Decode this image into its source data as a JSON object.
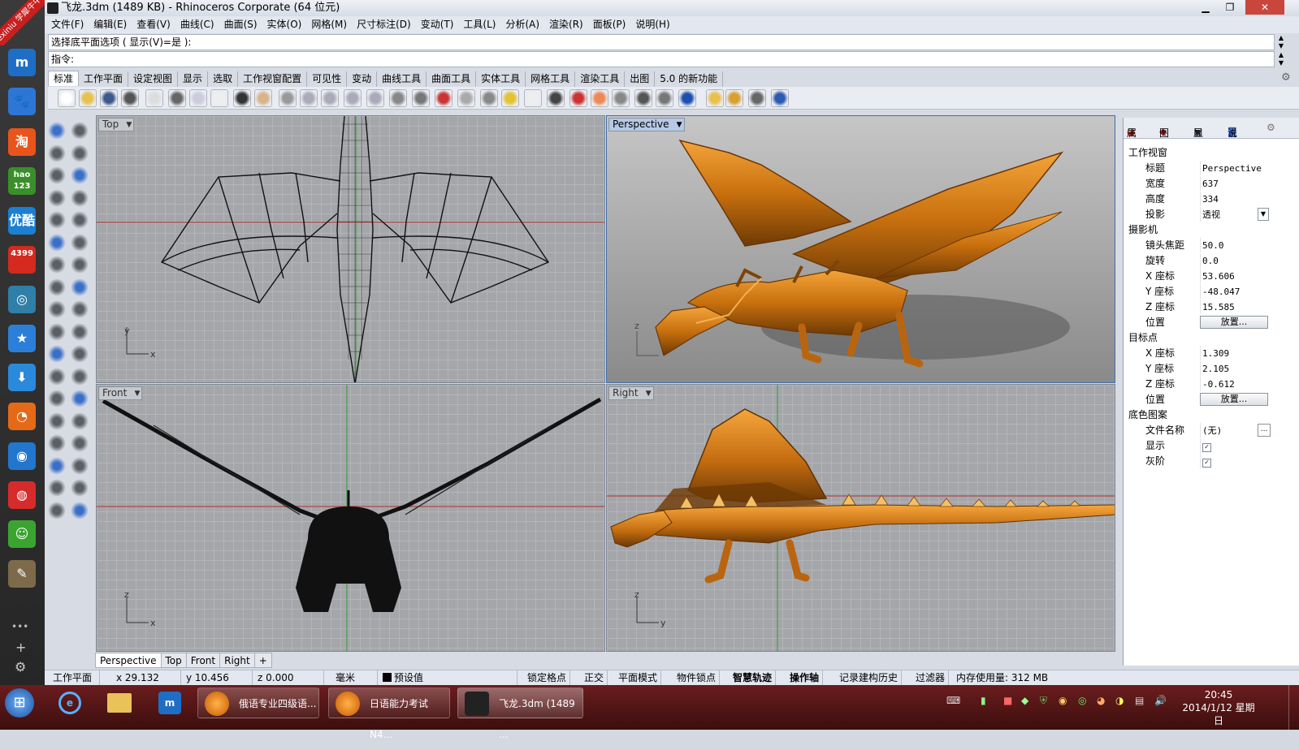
{
  "window": {
    "title": "飞龙.3dm (1489 KB) - Rhinoceros Corporate (64 位元)",
    "minimize": "▁",
    "restore": "❐",
    "close": "✕"
  },
  "dock_badge": {
    "line1": "xuexiniu",
    "line2": "学犀牛中文网"
  },
  "dock_items": [
    {
      "name": "maxthon-icon",
      "text": "m",
      "color": "#1f6ec6"
    },
    {
      "name": "baidu-icon",
      "text": "🐾",
      "color": "#2d76d6"
    },
    {
      "name": "taobao-icon",
      "text": "淘",
      "color": "#e8541c"
    },
    {
      "name": "hao123-icon",
      "text": "hao\n123",
      "color": "#3a8f2a"
    },
    {
      "name": "youku-icon",
      "text": "优酷",
      "color": "#1b7fd4"
    },
    {
      "name": "4399-icon",
      "text": "4399",
      "color": "#d42a1f"
    },
    {
      "name": "spiral-icon",
      "text": "◎",
      "color": "#2f7fa8"
    },
    {
      "name": "favorite-star-icon",
      "text": "★",
      "color": "#2c7fd8"
    },
    {
      "name": "download-icon",
      "text": "⬇",
      "color": "#2b89db"
    },
    {
      "name": "rss-icon",
      "text": "◔",
      "color": "#e46a18"
    },
    {
      "name": "game-controller-icon",
      "text": "◉",
      "color": "#2277cc"
    },
    {
      "name": "weibo-icon",
      "text": "◍",
      "color": "#d62b2b"
    },
    {
      "name": "smile-icon",
      "text": "☺",
      "color": "#3ba431"
    },
    {
      "name": "notepad-icon",
      "text": "✎",
      "color": "#7c6a4a"
    }
  ],
  "dock_more": "•••",
  "dock_add": "+",
  "dock_gear": "⚙",
  "menu": [
    "文件(F)",
    "编辑(E)",
    "查看(V)",
    "曲线(C)",
    "曲面(S)",
    "实体(O)",
    "网格(M)",
    "尺寸标注(D)",
    "变动(T)",
    "工具(L)",
    "分析(A)",
    "渲染(R)",
    "面板(P)",
    "说明(H)"
  ],
  "command_history": "选择底平面选项 ( 显示(V)=是 ):",
  "command_prompt": "指令:",
  "toolbar_tabs": [
    "标准",
    "工作平面",
    "设定视图",
    "显示",
    "选取",
    "工作视窗配置",
    "可见性",
    "变动",
    "曲线工具",
    "曲面工具",
    "实体工具",
    "网格工具",
    "渲染工具",
    "出图",
    "5.0 的新功能"
  ],
  "viewports": {
    "top": {
      "label": "Top"
    },
    "perspective": {
      "label": "Perspective"
    },
    "front": {
      "label": "Front"
    },
    "right": {
      "label": "Right"
    }
  },
  "axis_labels": {
    "x": "x",
    "y": "y",
    "z": "z"
  },
  "bottom_tabs": [
    "Perspective",
    "Top",
    "Front",
    "Right",
    "+"
  ],
  "status": {
    "cplane": "工作平面",
    "x": "x 29.132",
    "y": "y 10.456",
    "z": "z 0.000",
    "unit": "毫米",
    "layer": "预设值",
    "snap": "锁定格点",
    "ortho": "正交",
    "planar": "平面模式",
    "osnap": "物件锁点",
    "smarttrack": "智慧轨迹",
    "gumball": "操作轴",
    "history": "记录建构历史",
    "filter": "过滤器",
    "memory": "内存使用量: 312 MB"
  },
  "properties": {
    "tabs": [
      "属",
      "图",
      "显",
      "说"
    ],
    "section_viewport": "工作视窗",
    "title_label": "标题",
    "title_value": "Perspective",
    "width_label": "宽度",
    "width_value": "637",
    "height_label": "高度",
    "height_value": "334",
    "projection_label": "投影",
    "projection_value": "透视",
    "section_camera": "摄影机",
    "lens_label": "镜头焦距",
    "lens_value": "50.0",
    "rotation_label": "旋转",
    "rotation_value": "0.0",
    "cx_label": "X 座标",
    "cx_value": "53.606",
    "cy_label": "Y 座标",
    "cy_value": "-48.047",
    "cz_label": "Z 座标",
    "cz_value": "15.585",
    "cpos_label": "位置",
    "cpos_button": "放置...",
    "section_target": "目标点",
    "tx_label": "X 座标",
    "tx_value": "1.309",
    "ty_label": "Y 座标",
    "ty_value": "2.105",
    "tz_label": "Z 座标",
    "tz_value": "-0.612",
    "tpos_label": "位置",
    "tpos_button": "放置...",
    "section_wallpaper": "底色图案",
    "file_label": "文件名称",
    "file_value": "(无)",
    "file_button": "...",
    "show_label": "显示",
    "gray_label": "灰阶",
    "check_mark": "✓"
  },
  "taskbar": {
    "start": "⊞",
    "btn1": "俄语专业四级语...",
    "btn2": "日语能力考试N4...",
    "btn3": "飞龙.3dm (1489 ...",
    "time": "20:45",
    "date": "2014/1/12 星期日"
  }
}
